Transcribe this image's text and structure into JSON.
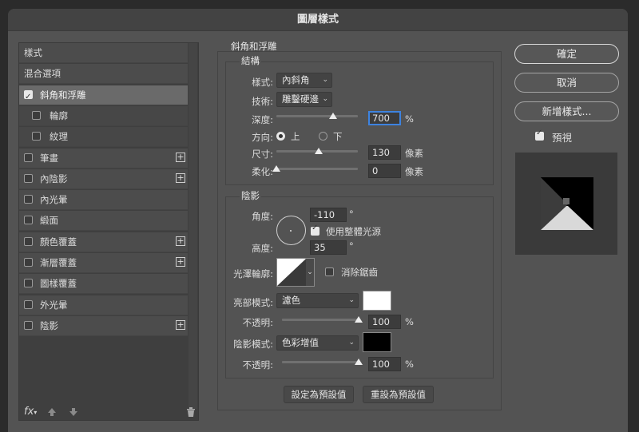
{
  "window": {
    "title": "圖層樣式"
  },
  "sidebar": {
    "items": [
      {
        "label": "樣式",
        "checkbox": false,
        "plus": false,
        "indent": 0,
        "selected": false
      },
      {
        "label": "混合選項",
        "checkbox": false,
        "plus": false,
        "indent": 0,
        "selected": false
      },
      {
        "label": "斜角和浮雕",
        "checkbox": true,
        "checked": true,
        "plus": false,
        "indent": 0,
        "selected": true
      },
      {
        "label": "輪廓",
        "checkbox": true,
        "checked": false,
        "plus": false,
        "indent": 1,
        "selected": false
      },
      {
        "label": "紋理",
        "checkbox": true,
        "checked": false,
        "plus": false,
        "indent": 1,
        "selected": false
      },
      {
        "label": "筆畫",
        "checkbox": true,
        "checked": false,
        "plus": true,
        "indent": 0,
        "selected": false
      },
      {
        "label": "內陰影",
        "checkbox": true,
        "checked": false,
        "plus": true,
        "indent": 0,
        "selected": false
      },
      {
        "label": "內光暈",
        "checkbox": true,
        "checked": false,
        "plus": false,
        "indent": 0,
        "selected": false
      },
      {
        "label": "緞面",
        "checkbox": true,
        "checked": false,
        "plus": false,
        "indent": 0,
        "selected": false
      },
      {
        "label": "顏色覆蓋",
        "checkbox": true,
        "checked": false,
        "plus": true,
        "indent": 0,
        "selected": false
      },
      {
        "label": "漸層覆蓋",
        "checkbox": true,
        "checked": false,
        "plus": true,
        "indent": 0,
        "selected": false
      },
      {
        "label": "圖樣覆蓋",
        "checkbox": true,
        "checked": false,
        "plus": false,
        "indent": 0,
        "selected": false
      },
      {
        "label": "外光暈",
        "checkbox": true,
        "checked": false,
        "plus": false,
        "indent": 0,
        "selected": false
      },
      {
        "label": "陰影",
        "checkbox": true,
        "checked": false,
        "plus": true,
        "indent": 0,
        "selected": false
      }
    ],
    "footer": {
      "fx_label": "fx",
      "icons": [
        "arrow-up-icon",
        "arrow-down-icon",
        "trash-icon"
      ]
    }
  },
  "bevel": {
    "section_title": "斜角和浮雕",
    "structure": {
      "title": "結構",
      "style_label": "樣式:",
      "style_value": "內斜角",
      "technique_label": "技術:",
      "technique_value": "雕鑿硬邊",
      "depth_label": "深度:",
      "depth_value": "700",
      "depth_unit": "%",
      "depth_level": 0.7,
      "direction_label": "方向:",
      "direction_up": "上",
      "direction_down": "下",
      "direction_selected": "上",
      "size_label": "尺寸:",
      "size_value": "130",
      "size_unit": "像素",
      "size_level": 0.52,
      "soften_label": "柔化:",
      "soften_value": "0",
      "soften_unit": "像素",
      "soften_level": 0.0
    },
    "shading": {
      "title": "陰影",
      "angle_label": "角度:",
      "angle_value": "-110",
      "angle_unit": "°",
      "global_light_label": "使用整體光源",
      "global_light_checked": true,
      "altitude_label": "高度:",
      "altitude_value": "35",
      "altitude_unit": "°",
      "gloss_label": "光澤輪廓:",
      "antialias_label": "消除鋸齒",
      "antialias_checked": false,
      "highlight_mode_label": "亮部模式:",
      "highlight_mode_value": "濾色",
      "highlight_color": "#ffffff",
      "highlight_opacity_label": "不透明:",
      "highlight_opacity_value": "100",
      "highlight_opacity_unit": "%",
      "highlight_opacity_level": 1.0,
      "shadow_mode_label": "陰影模式:",
      "shadow_mode_value": "色彩增值",
      "shadow_color": "#000000",
      "shadow_opacity_label": "不透明:",
      "shadow_opacity_value": "100",
      "shadow_opacity_unit": "%",
      "shadow_opacity_level": 1.0
    },
    "make_default": "設定為預設值",
    "reset_default": "重設為預設值"
  },
  "actions": {
    "ok": "確定",
    "cancel": "取消",
    "new_style": "新增樣式...",
    "preview_label": "預視",
    "preview_checked": true
  },
  "colors": {
    "accent": "#3d83e0",
    "dialog_bg": "#535353"
  }
}
